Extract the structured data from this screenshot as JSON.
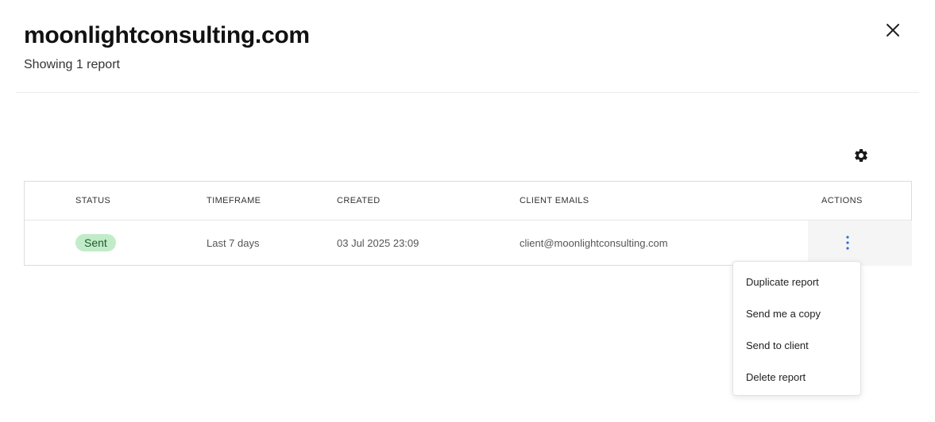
{
  "header": {
    "title": "moonlightconsulting.com",
    "subtitle": "Showing 1 report"
  },
  "icons": {
    "close": "close-icon",
    "settings": "gear-icon",
    "row_actions": "more-vertical-icon"
  },
  "table": {
    "columns": [
      "STATUS",
      "TIMEFRAME",
      "CREATED",
      "CLIENT EMAILS",
      "ACTIONS"
    ],
    "rows": [
      {
        "status": "Sent",
        "timeframe": "Last 7 days",
        "created": "03 Jul 2025 23:09",
        "client_emails": "client@moonlightconsulting.com"
      }
    ]
  },
  "actions_menu": {
    "items": [
      "Duplicate report",
      "Send me a copy",
      "Send to client",
      "Delete report"
    ]
  },
  "colors": {
    "status_badge_bg": "#c2ecc9",
    "status_badge_text": "#1d5a2a",
    "kebab_accent": "#2f6fd6"
  }
}
